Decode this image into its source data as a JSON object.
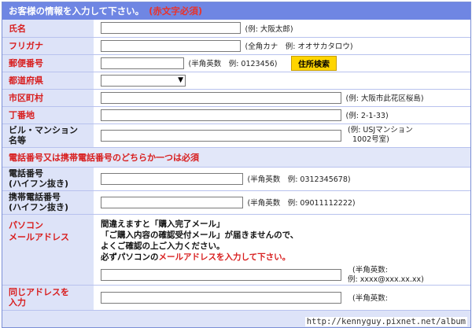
{
  "header": {
    "title": "お客様の情報を入力して下さい。",
    "required_note": "(赤文字必須)"
  },
  "fields": {
    "name": {
      "label": "氏名",
      "hint": "(例: 大阪太郎)"
    },
    "kana": {
      "label": "フリガナ",
      "hint": "(全角カナ　例: オオサカタロウ)"
    },
    "postal": {
      "label": "郵便番号",
      "hint": "(半角英数　例: 0123456)",
      "button": "住所検索"
    },
    "prefecture": {
      "label": "都道府県"
    },
    "city": {
      "label": "市区町村",
      "hint": "(例: 大阪市此花区桜島)"
    },
    "block": {
      "label": "丁番地",
      "hint": "(例: 2-1-33)"
    },
    "building": {
      "label_line1": "ビル・マンション",
      "label_line2": "名等",
      "hint_line1": "(例: USJマンション",
      "hint_line2": "1002号室)"
    },
    "phone_notice": "電話番号又は携帯電話番号のどちらか一つは必須",
    "phone": {
      "label_line1": "電話番号",
      "label_line2": "(ハイフン抜き)",
      "hint": "(半角英数　例: 0312345678)"
    },
    "mobile": {
      "label_line1": "携帯電話番号",
      "label_line2": "(ハイフン抜き)",
      "hint": "(半角英数　例: 09011112222)"
    },
    "email": {
      "label_line1": "パソコン",
      "label_line2": "メールアドレス",
      "msg_line1": "間違えますと「購入完了メール」",
      "msg_line2": "「ご購入内容の確認受付メール」が届きませんので、",
      "msg_line3": "よくご確認の上ご入力ください。",
      "msg_line4_prefix": "必ずパソコンの",
      "msg_line4_red": "メールアドレスを入力して下さい。",
      "hint_line1": "(半角英数:",
      "hint_line2": "例: xxxx@xxx.xx.xx)"
    },
    "email_confirm": {
      "label_line1": "同じアドレスを",
      "label_line2": "入力",
      "hint_line1": "(半角英数:"
    }
  },
  "watermark": "http://kennyguy.pixnet.net/album"
}
